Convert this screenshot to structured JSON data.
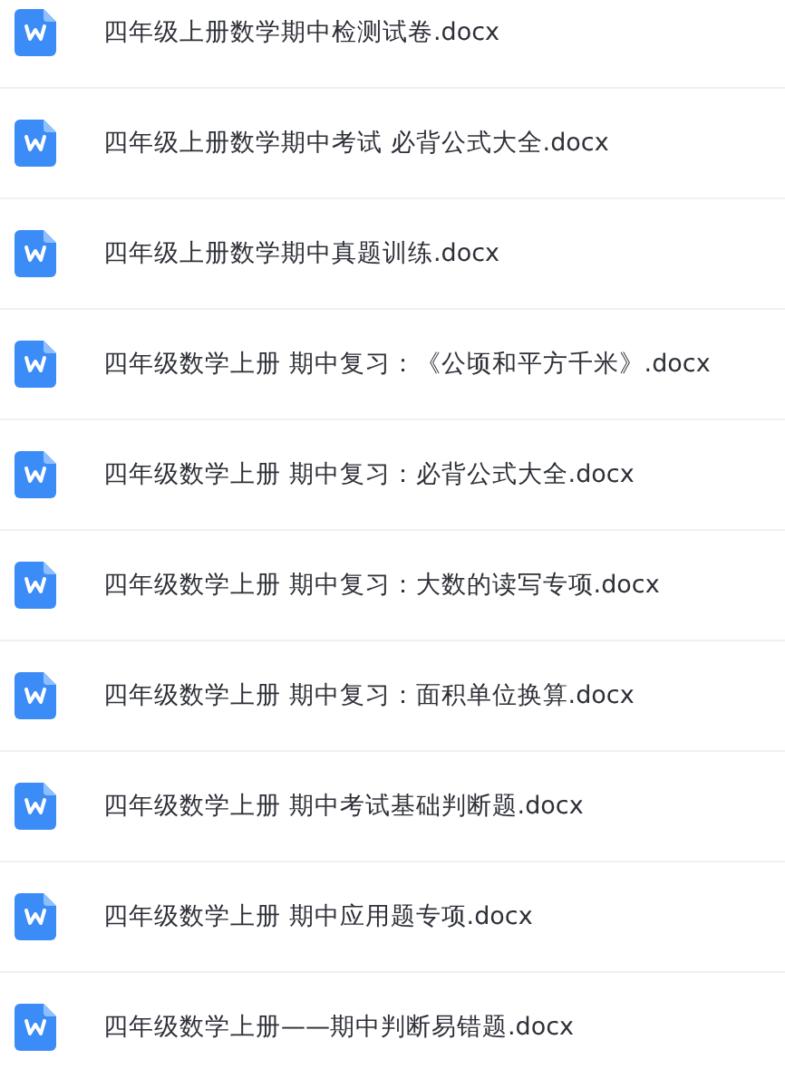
{
  "files": [
    {
      "name": "四年级上册数学期中检测试卷.docx"
    },
    {
      "name": "四年级上册数学期中考试 必背公式大全.docx"
    },
    {
      "name": "四年级上册数学期中真题训练.docx"
    },
    {
      "name": "四年级数学上册 期中复习：《公顷和平方千米》.docx"
    },
    {
      "name": "四年级数学上册 期中复习：必背公式大全.docx"
    },
    {
      "name": "四年级数学上册 期中复习：大数的读写专项.docx"
    },
    {
      "name": "四年级数学上册 期中复习：面积单位换算.docx"
    },
    {
      "name": "四年级数学上册 期中考试基础判断题.docx"
    },
    {
      "name": "四年级数学上册 期中应用题专项.docx"
    },
    {
      "name": "四年级数学上册——期中判断易错题.docx"
    }
  ]
}
